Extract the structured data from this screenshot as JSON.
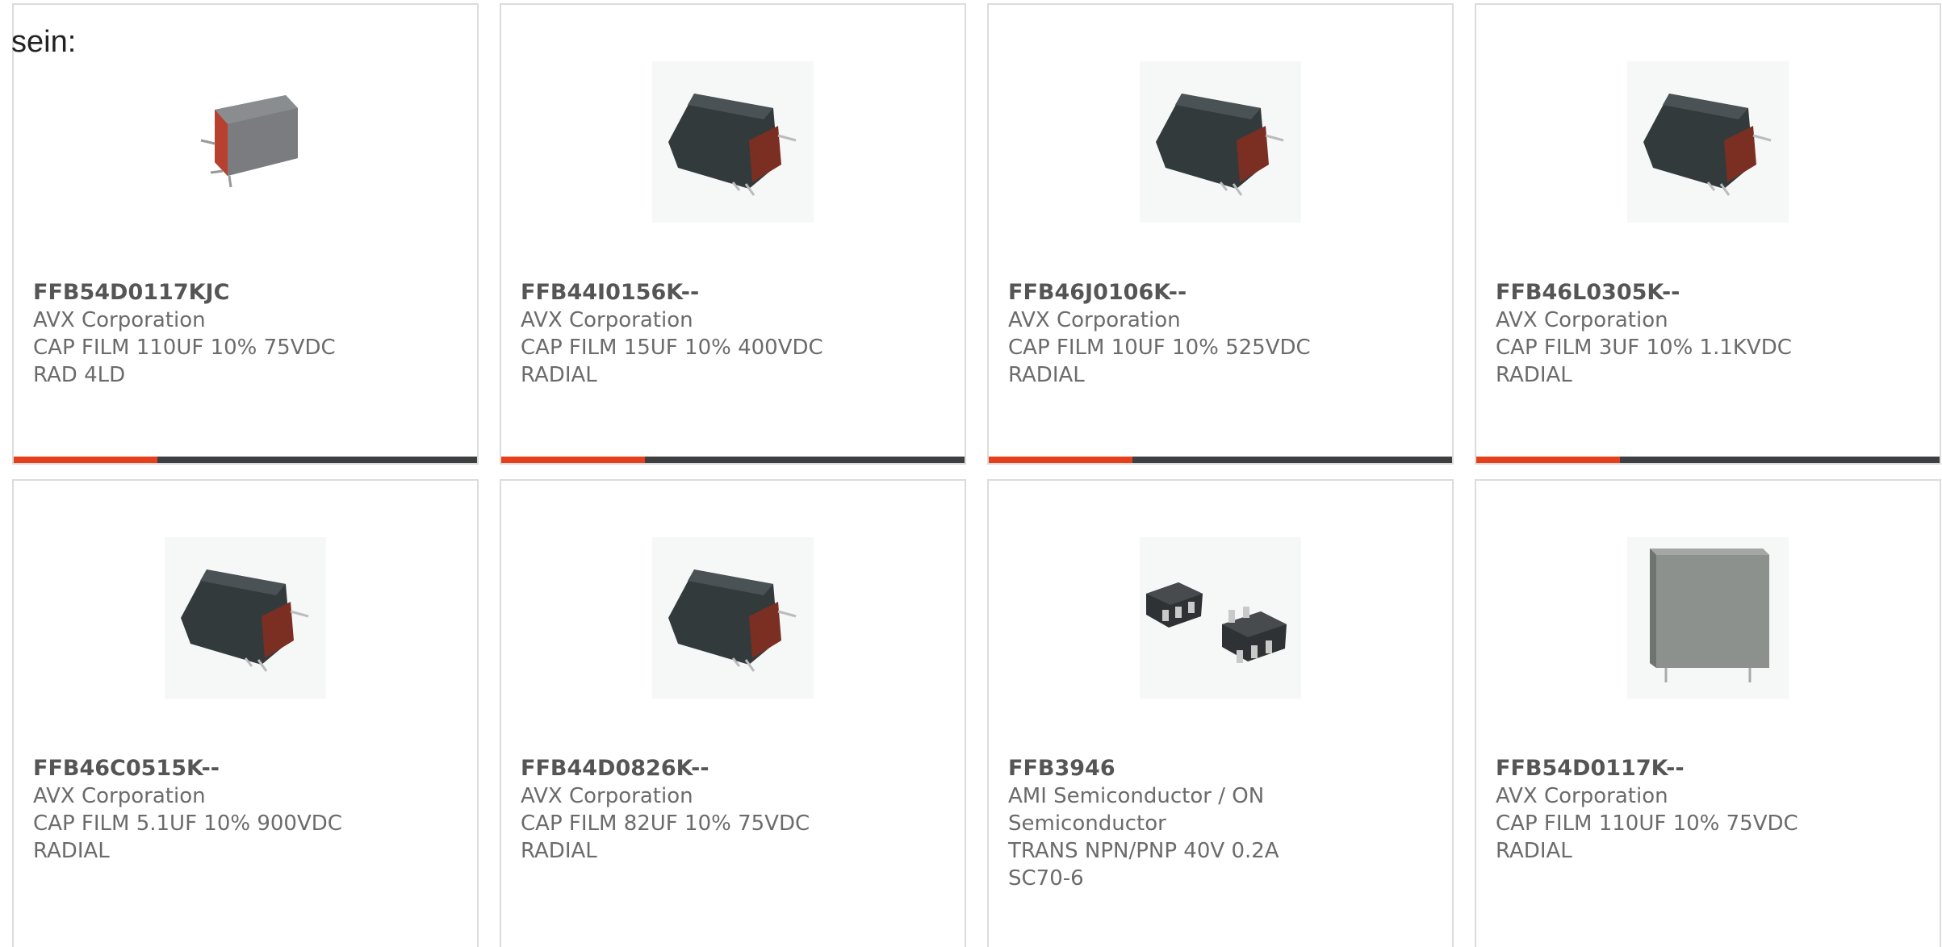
{
  "page": {
    "lead_text": "sein:"
  },
  "colors": {
    "accent": "#e5401c",
    "bar_dark": "#3d3f41",
    "card_border": "#dcdcdc"
  },
  "products": [
    {
      "part_number": "FFB54D0117KJC",
      "manufacturer": "AVX Corporation",
      "description": "CAP FILM 110UF 10% 75VDC RAD 4LD",
      "image_icon": "red-film-capacitor-icon",
      "accent_fraction": 0.31
    },
    {
      "part_number": "FFB44I0156K--",
      "manufacturer": "AVX Corporation",
      "description": "CAP FILM 15UF 10% 400VDC RADIAL",
      "image_icon": "dark-film-capacitor-icon",
      "accent_fraction": 0.31
    },
    {
      "part_number": "FFB46J0106K--",
      "manufacturer": "AVX Corporation",
      "description": "CAP FILM 10UF 10% 525VDC RADIAL",
      "image_icon": "dark-film-capacitor-icon",
      "accent_fraction": 0.31
    },
    {
      "part_number": "FFB46L0305K--",
      "manufacturer": "AVX Corporation",
      "description": "CAP FILM 3UF 10% 1.1KVDC RADIAL",
      "image_icon": "dark-film-capacitor-icon",
      "accent_fraction": 0.31
    },
    {
      "part_number": "FFB46C0515K--",
      "manufacturer": "AVX Corporation",
      "description": "CAP FILM 5.1UF 10% 900VDC RADIAL",
      "image_icon": "dark-film-capacitor-icon"
    },
    {
      "part_number": "FFB44D0826K--",
      "manufacturer": "AVX Corporation",
      "description": "CAP FILM 82UF 10% 75VDC RADIAL",
      "image_icon": "dark-film-capacitor-icon"
    },
    {
      "part_number": "FFB3946",
      "manufacturer": "AMI Semiconductor / ON Semiconductor",
      "description": "TRANS NPN/PNP 40V 0.2A SC70-6",
      "image_icon": "sc70-transistor-icon"
    },
    {
      "part_number": "FFB54D0117K--",
      "manufacturer": "AVX Corporation",
      "description": "CAP FILM 110UF 10% 75VDC RADIAL",
      "image_icon": "gray-film-capacitor-icon"
    }
  ]
}
